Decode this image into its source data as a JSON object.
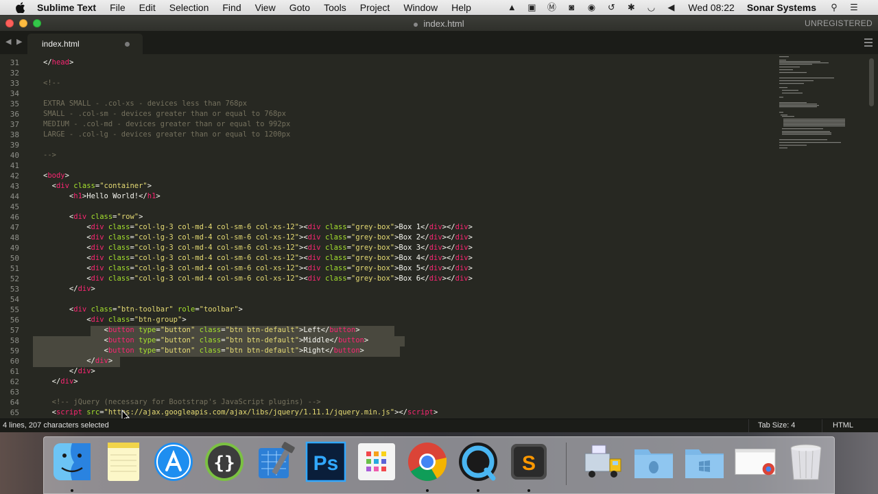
{
  "menubar": {
    "app_name": "Sublime Text",
    "menus": [
      "File",
      "Edit",
      "Selection",
      "Find",
      "View",
      "Goto",
      "Tools",
      "Project",
      "Window",
      "Help"
    ],
    "clock": "Wed 08:22",
    "user": "Sonar Systems"
  },
  "window": {
    "title": "index.html",
    "registration": "UNREGISTERED"
  },
  "tab": {
    "label": "index.html"
  },
  "gutter": {
    "line_numbers": [
      "31",
      "32",
      "33",
      "34",
      "35",
      "36",
      "37",
      "38",
      "39",
      "40",
      "41",
      "42",
      "43",
      "44",
      "45",
      "46",
      "47",
      "48",
      "49",
      "50",
      "51",
      "52",
      "53",
      "54",
      "55",
      "56",
      "57",
      "58",
      "59",
      "60",
      "61",
      "62",
      "63",
      "64",
      "65"
    ]
  },
  "code": {
    "lines": [
      [
        [
          "p",
          "</"
        ],
        [
          "t",
          "head"
        ],
        [
          "p",
          ">"
        ]
      ],
      [],
      [
        [
          "c",
          "<!--"
        ]
      ],
      [],
      [
        [
          "c",
          "EXTRA SMALL - .col-xs - devices less than 768px"
        ]
      ],
      [
        [
          "c",
          "SMALL - .col-sm - devices greater than or equal to 768px"
        ]
      ],
      [
        [
          "c",
          "MEDIUM - .col-md - devices greater than or equal to 992px"
        ]
      ],
      [
        [
          "c",
          "LARGE - .col-lg - devices greater than or equal to 1200px"
        ]
      ],
      [],
      [
        [
          "c",
          "-->"
        ]
      ],
      [],
      [
        [
          "p",
          "<"
        ],
        [
          "t",
          "body"
        ],
        [
          "p",
          ">"
        ]
      ],
      [
        [
          "p",
          "  <"
        ],
        [
          "t",
          "div"
        ],
        [
          "p",
          " "
        ],
        [
          "a",
          "class"
        ],
        [
          "p",
          "="
        ],
        [
          "s",
          "\"container\""
        ],
        [
          "p",
          ">"
        ]
      ],
      [
        [
          "p",
          "      <"
        ],
        [
          "t",
          "h1"
        ],
        [
          "p",
          ">Hello World!</"
        ],
        [
          "t",
          "h1"
        ],
        [
          "p",
          ">"
        ]
      ],
      [],
      [
        [
          "p",
          "      <"
        ],
        [
          "t",
          "div"
        ],
        [
          "p",
          " "
        ],
        [
          "a",
          "class"
        ],
        [
          "p",
          "="
        ],
        [
          "s",
          "\"row\""
        ],
        [
          "p",
          ">"
        ]
      ],
      [
        [
          "p",
          "          <"
        ],
        [
          "t",
          "div"
        ],
        [
          "p",
          " "
        ],
        [
          "a",
          "class"
        ],
        [
          "p",
          "="
        ],
        [
          "s",
          "\"col-lg-3 col-md-4 col-sm-6 col-xs-12\""
        ],
        [
          "p",
          "><"
        ],
        [
          "t",
          "div"
        ],
        [
          "p",
          " "
        ],
        [
          "a",
          "class"
        ],
        [
          "p",
          "="
        ],
        [
          "s",
          "\"grey-box\""
        ],
        [
          "p",
          ">Box 1</"
        ],
        [
          "t",
          "div"
        ],
        [
          "p",
          "></"
        ],
        [
          "t",
          "div"
        ],
        [
          "p",
          ">"
        ]
      ],
      [
        [
          "p",
          "          <"
        ],
        [
          "t",
          "div"
        ],
        [
          "p",
          " "
        ],
        [
          "a",
          "class"
        ],
        [
          "p",
          "="
        ],
        [
          "s",
          "\"col-lg-3 col-md-4 col-sm-6 col-xs-12\""
        ],
        [
          "p",
          "><"
        ],
        [
          "t",
          "div"
        ],
        [
          "p",
          " "
        ],
        [
          "a",
          "class"
        ],
        [
          "p",
          "="
        ],
        [
          "s",
          "\"grey-box\""
        ],
        [
          "p",
          ">Box 2</"
        ],
        [
          "t",
          "div"
        ],
        [
          "p",
          "></"
        ],
        [
          "t",
          "div"
        ],
        [
          "p",
          ">"
        ]
      ],
      [
        [
          "p",
          "          <"
        ],
        [
          "t",
          "div"
        ],
        [
          "p",
          " "
        ],
        [
          "a",
          "class"
        ],
        [
          "p",
          "="
        ],
        [
          "s",
          "\"col-lg-3 col-md-4 col-sm-6 col-xs-12\""
        ],
        [
          "p",
          "><"
        ],
        [
          "t",
          "div"
        ],
        [
          "p",
          " "
        ],
        [
          "a",
          "class"
        ],
        [
          "p",
          "="
        ],
        [
          "s",
          "\"grey-box\""
        ],
        [
          "p",
          ">Box 3</"
        ],
        [
          "t",
          "div"
        ],
        [
          "p",
          "></"
        ],
        [
          "t",
          "div"
        ],
        [
          "p",
          ">"
        ]
      ],
      [
        [
          "p",
          "          <"
        ],
        [
          "t",
          "div"
        ],
        [
          "p",
          " "
        ],
        [
          "a",
          "class"
        ],
        [
          "p",
          "="
        ],
        [
          "s",
          "\"col-lg-3 col-md-4 col-sm-6 col-xs-12\""
        ],
        [
          "p",
          "><"
        ],
        [
          "t",
          "div"
        ],
        [
          "p",
          " "
        ],
        [
          "a",
          "class"
        ],
        [
          "p",
          "="
        ],
        [
          "s",
          "\"grey-box\""
        ],
        [
          "p",
          ">Box 4</"
        ],
        [
          "t",
          "div"
        ],
        [
          "p",
          "></"
        ],
        [
          "t",
          "div"
        ],
        [
          "p",
          ">"
        ]
      ],
      [
        [
          "p",
          "          <"
        ],
        [
          "t",
          "div"
        ],
        [
          "p",
          " "
        ],
        [
          "a",
          "class"
        ],
        [
          "p",
          "="
        ],
        [
          "s",
          "\"col-lg-3 col-md-4 col-sm-6 col-xs-12\""
        ],
        [
          "p",
          "><"
        ],
        [
          "t",
          "div"
        ],
        [
          "p",
          " "
        ],
        [
          "a",
          "class"
        ],
        [
          "p",
          "="
        ],
        [
          "s",
          "\"grey-box\""
        ],
        [
          "p",
          ">Box 5</"
        ],
        [
          "t",
          "div"
        ],
        [
          "p",
          "></"
        ],
        [
          "t",
          "div"
        ],
        [
          "p",
          ">"
        ]
      ],
      [
        [
          "p",
          "          <"
        ],
        [
          "t",
          "div"
        ],
        [
          "p",
          " "
        ],
        [
          "a",
          "class"
        ],
        [
          "p",
          "="
        ],
        [
          "s",
          "\"col-lg-3 col-md-4 col-sm-6 col-xs-12\""
        ],
        [
          "p",
          "><"
        ],
        [
          "t",
          "div"
        ],
        [
          "p",
          " "
        ],
        [
          "a",
          "class"
        ],
        [
          "p",
          "="
        ],
        [
          "s",
          "\"grey-box\""
        ],
        [
          "p",
          ">Box 6</"
        ],
        [
          "t",
          "div"
        ],
        [
          "p",
          "></"
        ],
        [
          "t",
          "div"
        ],
        [
          "p",
          ">"
        ]
      ],
      [
        [
          "p",
          "      </"
        ],
        [
          "t",
          "div"
        ],
        [
          "p",
          ">"
        ]
      ],
      [],
      [
        [
          "p",
          "      <"
        ],
        [
          "t",
          "div"
        ],
        [
          "p",
          " "
        ],
        [
          "a",
          "class"
        ],
        [
          "p",
          "="
        ],
        [
          "s",
          "\"btn-toolbar\""
        ],
        [
          "p",
          " "
        ],
        [
          "a",
          "role"
        ],
        [
          "p",
          "="
        ],
        [
          "s",
          "\"toolbar\""
        ],
        [
          "p",
          ">"
        ]
      ],
      [
        [
          "p",
          "          <"
        ],
        [
          "t",
          "div"
        ],
        [
          "p",
          " "
        ],
        [
          "a",
          "class"
        ],
        [
          "p",
          "="
        ],
        [
          "s",
          "\"btn-group\""
        ],
        [
          "p",
          ">"
        ]
      ],
      [
        [
          "p",
          "              <"
        ],
        [
          "t",
          "button"
        ],
        [
          "p",
          " "
        ],
        [
          "a",
          "type"
        ],
        [
          "p",
          "="
        ],
        [
          "s",
          "\"button\""
        ],
        [
          "p",
          " "
        ],
        [
          "a",
          "class"
        ],
        [
          "p",
          "="
        ],
        [
          "s",
          "\"btn btn-default\""
        ],
        [
          "p",
          ">Left</"
        ],
        [
          "t",
          "button"
        ],
        [
          "p",
          ">"
        ]
      ],
      [
        [
          "p",
          "              <"
        ],
        [
          "t",
          "button"
        ],
        [
          "p",
          " "
        ],
        [
          "a",
          "type"
        ],
        [
          "p",
          "="
        ],
        [
          "s",
          "\"button\""
        ],
        [
          "p",
          " "
        ],
        [
          "a",
          "class"
        ],
        [
          "p",
          "="
        ],
        [
          "s",
          "\"btn btn-default\""
        ],
        [
          "p",
          ">Middle</"
        ],
        [
          "t",
          "button"
        ],
        [
          "p",
          ">"
        ]
      ],
      [
        [
          "p",
          "              <"
        ],
        [
          "t",
          "button"
        ],
        [
          "p",
          " "
        ],
        [
          "a",
          "type"
        ],
        [
          "p",
          "="
        ],
        [
          "s",
          "\"button\""
        ],
        [
          "p",
          " "
        ],
        [
          "a",
          "class"
        ],
        [
          "p",
          "="
        ],
        [
          "s",
          "\"btn btn-default\""
        ],
        [
          "p",
          ">Right</"
        ],
        [
          "t",
          "button"
        ],
        [
          "p",
          ">"
        ]
      ],
      [
        [
          "p",
          "          </"
        ],
        [
          "t",
          "div"
        ],
        [
          "p",
          ">"
        ]
      ],
      [
        [
          "p",
          "      </"
        ],
        [
          "t",
          "div"
        ],
        [
          "p",
          ">"
        ]
      ],
      [
        [
          "p",
          "  </"
        ],
        [
          "t",
          "div"
        ],
        [
          "p",
          ">"
        ]
      ],
      [],
      [
        [
          "p",
          "  "
        ],
        [
          "c",
          "<!-- jQuery (necessary for Bootstrap's JavaScript plugins) -->"
        ]
      ],
      [
        [
          "p",
          "  <"
        ],
        [
          "t",
          "script"
        ],
        [
          "p",
          " "
        ],
        [
          "a",
          "src"
        ],
        [
          "p",
          "="
        ],
        [
          "s",
          "\"https://ajax.googleapis.com/ajax/libs/jquery/1.11.1/jquery.min.js\""
        ],
        [
          "p",
          "></"
        ],
        [
          "t",
          "script"
        ],
        [
          "p",
          ">"
        ]
      ]
    ]
  },
  "statusbar": {
    "selection": "4 lines, 207 characters selected",
    "tab_size": "Tab Size: 4",
    "syntax": "HTML"
  },
  "dock": {
    "items": [
      "finder-icon",
      "notes-icon",
      "app-store-icon",
      "brackets-icon",
      "xcode-icon",
      "photoshop-icon",
      "launchpad-icon",
      "chrome-icon",
      "quicktime-icon",
      "sublime-text-icon",
      "utility-truck-icon",
      "linux-folder-icon",
      "windows-folder-icon",
      "downloads-stack-icon",
      "trash-icon"
    ]
  },
  "colors": {
    "editor_bg": "#272822",
    "tag": "#f92672",
    "attribute": "#a6e22e",
    "string": "#e6db74",
    "comment": "#75715e",
    "selection": "#49483e"
  }
}
